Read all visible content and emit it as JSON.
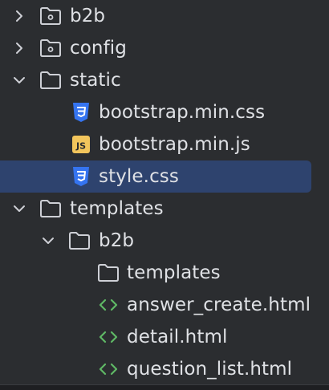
{
  "colors": {
    "background": "#2b2d30",
    "selection": "#2e436e",
    "text": "#dfe1e5",
    "icon_gray": "#ced0d6",
    "css_blue": "#3574f0",
    "js_yellow": "#f2c55c",
    "html_green": "#5fb865"
  },
  "tree": {
    "items": [
      {
        "label": "b2b",
        "icon": "package-folder-icon",
        "expanded": false
      },
      {
        "label": "config",
        "icon": "package-folder-icon",
        "expanded": false
      },
      {
        "label": "static",
        "icon": "folder-icon",
        "expanded": true
      },
      {
        "label": "bootstrap.min.css",
        "icon": "css-file-icon"
      },
      {
        "label": "bootstrap.min.js",
        "icon": "js-file-icon",
        "badge": "JS"
      },
      {
        "label": "style.css",
        "icon": "css-file-icon",
        "selected": true
      },
      {
        "label": "templates",
        "icon": "folder-icon",
        "expanded": true
      },
      {
        "label": "b2b",
        "icon": "folder-icon",
        "expanded": true
      },
      {
        "label": "templates",
        "icon": "folder-icon"
      },
      {
        "label": "answer_create.html",
        "icon": "html-file-icon"
      },
      {
        "label": "detail.html",
        "icon": "html-file-icon"
      },
      {
        "label": "question_list.html",
        "icon": "html-file-icon"
      }
    ]
  }
}
